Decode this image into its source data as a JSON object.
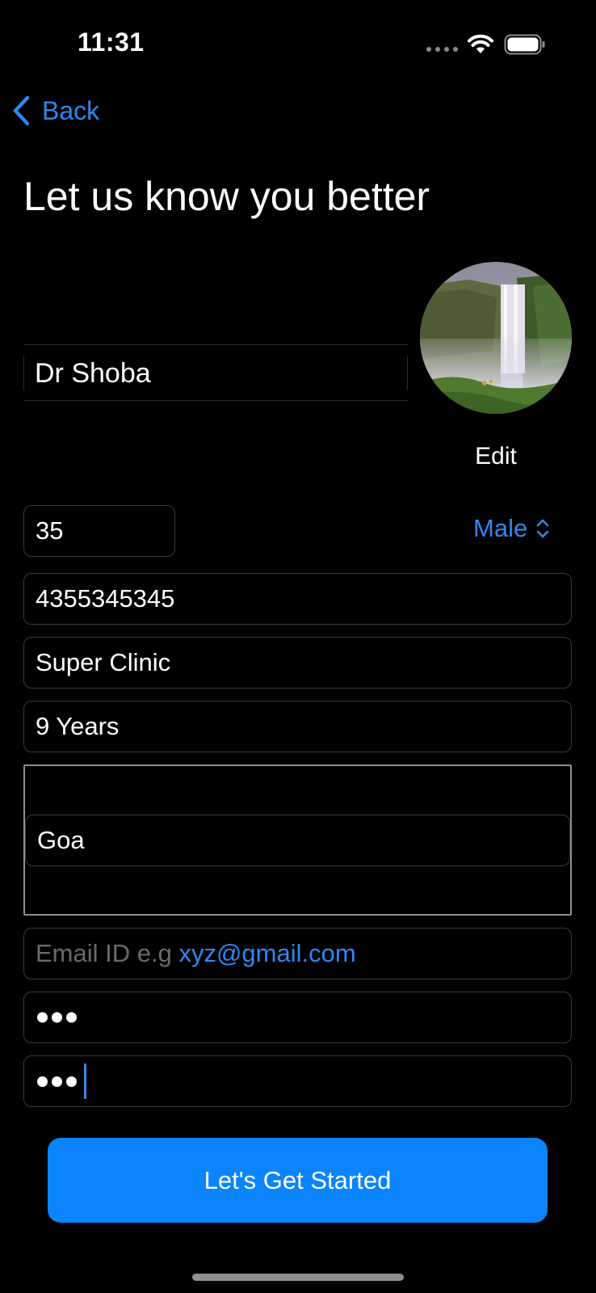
{
  "status_bar": {
    "time": "11:31"
  },
  "nav": {
    "back_label": "Back"
  },
  "page": {
    "title": "Let us know you better"
  },
  "profile": {
    "name": "Dr Shoba",
    "edit_label": "Edit"
  },
  "form": {
    "age": "35",
    "gender": "Male",
    "phone": "4355345345",
    "clinic": "Super Clinic",
    "experience": "9 Years",
    "location": "Goa",
    "email_placeholder_prefix": "Email ID e.g ",
    "email_placeholder_example": "xyz@gmail.com",
    "password_masked_count": 3,
    "confirm_password_masked_count": 3
  },
  "cta": {
    "label": "Let's Get Started"
  },
  "colors": {
    "background": "#000000",
    "accent": "#0a84ff",
    "link": "#2f87f0",
    "field_border": "#3a3a3c",
    "placeholder": "#6a6a6e"
  },
  "icons": {
    "back": "chevron-left-icon",
    "gender_select": "chevron-up-down-icon",
    "wifi": "wifi-icon",
    "battery": "battery-icon",
    "signal": "cellular-signal-icon"
  }
}
